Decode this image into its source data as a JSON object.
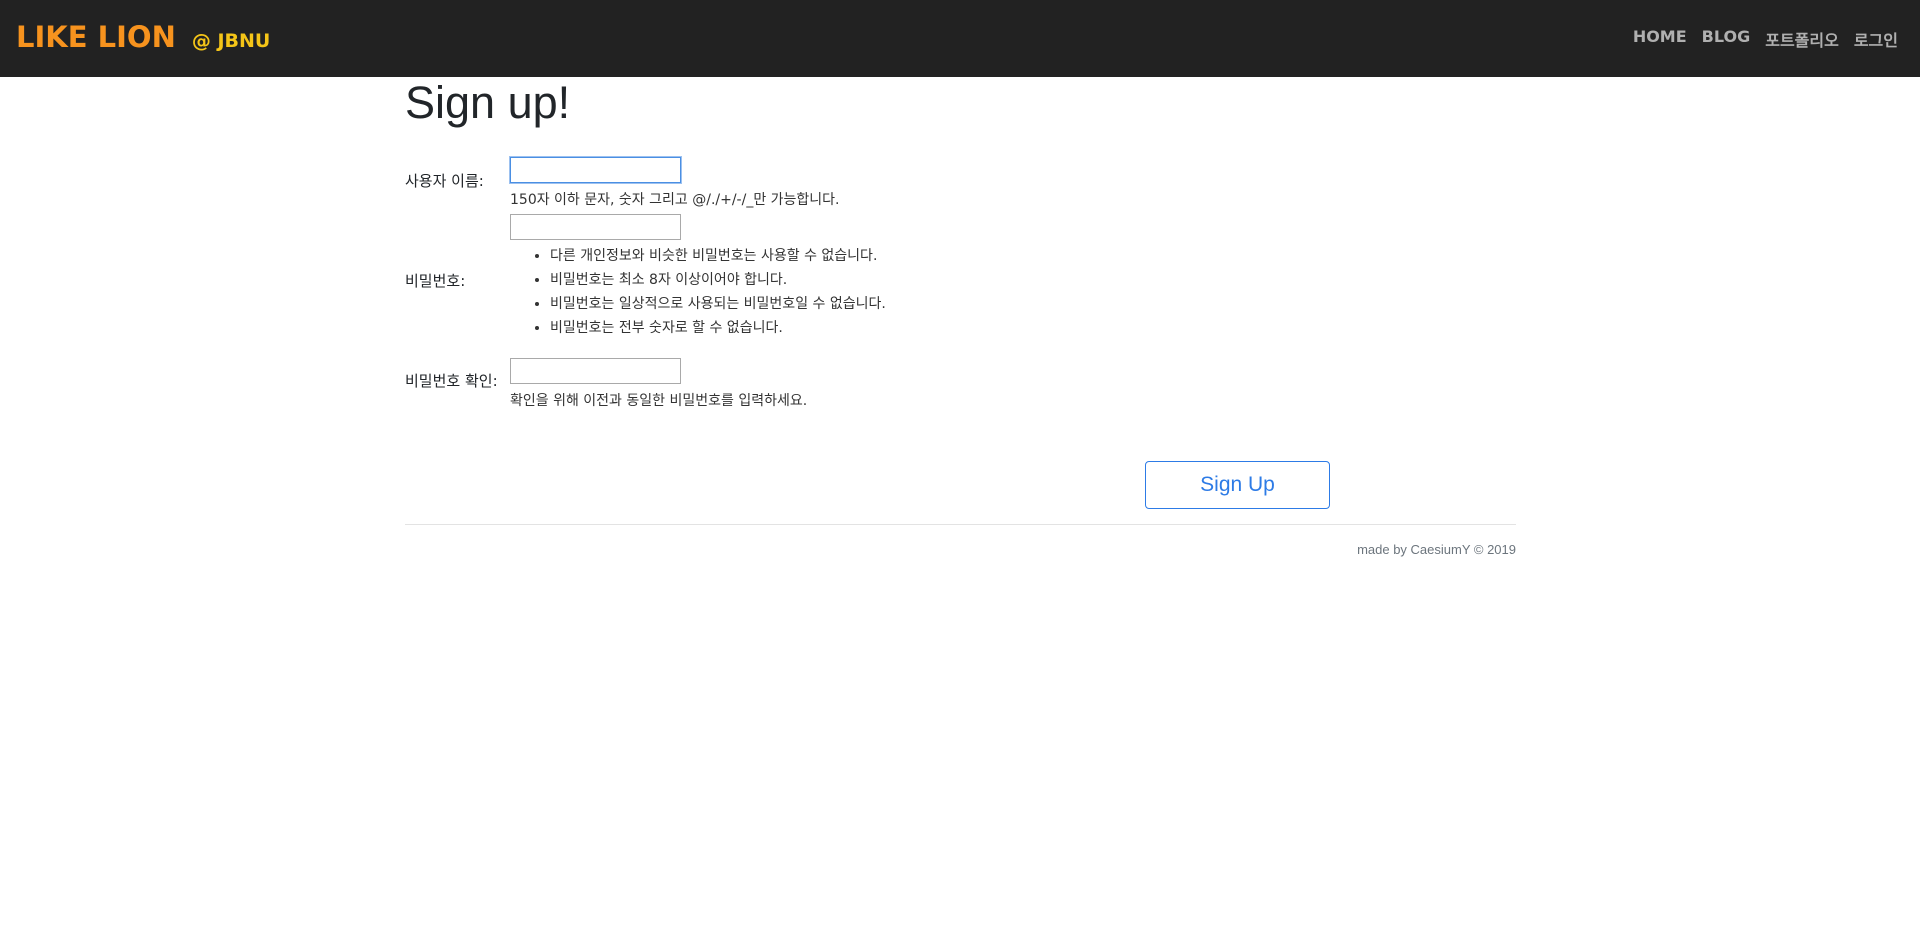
{
  "header": {
    "brand_main": "LIKE LION",
    "brand_sub": "@ JBNU",
    "nav": [
      "HOME",
      "BLOG",
      "포트폴리오",
      "로그인"
    ]
  },
  "form": {
    "title": "Sign up!",
    "username_label": "사용자 이름:",
    "username_value": "",
    "username_help": "150자 이하 문자, 숫자 그리고 @/./+/-/_만 가능합니다.",
    "password_label": "비밀번호:",
    "password_value": "",
    "password_rules": [
      "다른 개인정보와 비슷한 비밀번호는 사용할 수 없습니다.",
      "비밀번호는 최소 8자 이상이어야 합니다.",
      "비밀번호는 일상적으로 사용되는 비밀번호일 수 없습니다.",
      "비밀번호는 전부 숫자로 할 수 없습니다."
    ],
    "password_confirm_label": "비밀번호 확인:",
    "password_confirm_value": "",
    "password_confirm_help": "확인을 위해 이전과 동일한 비밀번호를 입력하세요.",
    "submit_label": "Sign Up"
  },
  "footer": {
    "text": "made by CaesiumY © 2019"
  },
  "colors": {
    "navbar_bg": "#222222",
    "brand_orange": "#f7931e",
    "brand_yellow": "#f5c518",
    "accent_blue": "#2d7be6"
  }
}
